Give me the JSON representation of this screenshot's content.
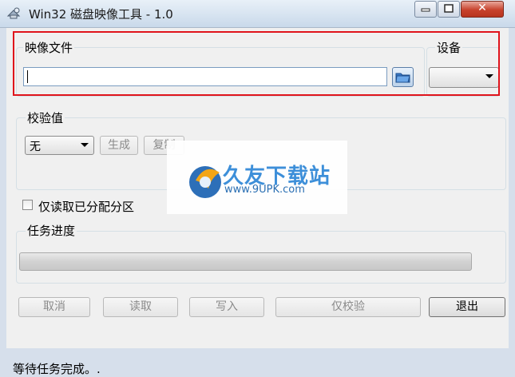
{
  "window": {
    "title": "Win32 磁盘映像工具 - 1.0",
    "close_label": "✕"
  },
  "image_file": {
    "legend": "映像文件",
    "value": ""
  },
  "device": {
    "legend": "设备",
    "selected": ""
  },
  "checksum": {
    "legend": "校验值",
    "selected": "无",
    "generate_label": "生成",
    "copy_label": "复制"
  },
  "read_only_allocated": {
    "label": "仅读取已分配分区",
    "checked": false
  },
  "progress": {
    "legend": "任务进度",
    "value": 0
  },
  "buttons": {
    "cancel": "取消",
    "read": "读取",
    "write": "写入",
    "verify": "仅校验",
    "exit": "退出"
  },
  "status": "等待任务完成。.",
  "watermark": {
    "brand": "久友下载站",
    "url": "www.9UPK.com"
  },
  "colors": {
    "highlight_border": "#e0141c",
    "title_bar": "#c9d9ea",
    "close_button": "#c7422c",
    "watermark_text": "#3d8fd9"
  }
}
